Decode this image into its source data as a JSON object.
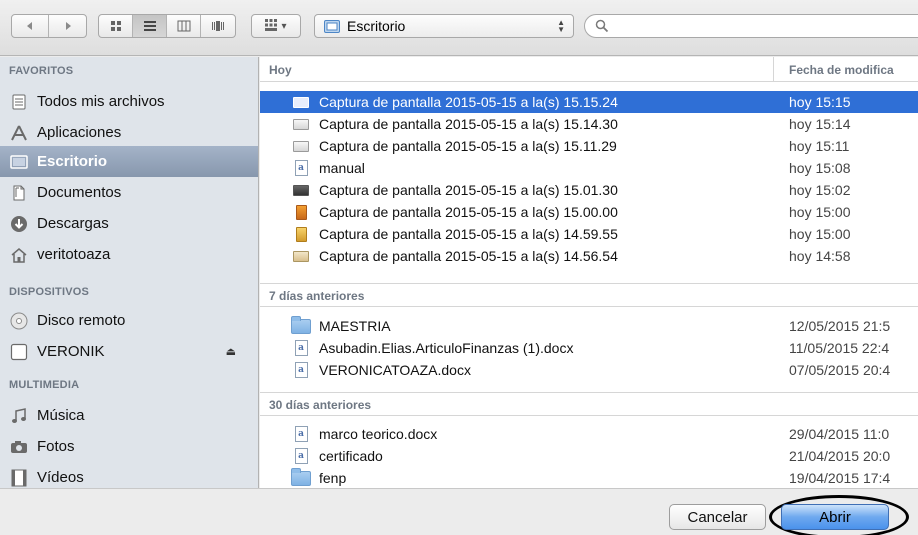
{
  "toolbar": {
    "nav": [
      {
        "icon": "back-arrow-icon",
        "glyph": "◀"
      },
      {
        "icon": "forward-arrow-icon",
        "glyph": "▶"
      }
    ],
    "views": [
      {
        "icon": "icon-view-icon"
      },
      {
        "icon": "list-view-icon",
        "active": true
      },
      {
        "icon": "column-view-icon"
      },
      {
        "icon": "coverflow-view-icon"
      }
    ],
    "arrange": {
      "icon": "arrange-grid-icon",
      "chevron": "▾"
    },
    "location": {
      "label": "Escritorio",
      "icon": "desktop-folder-icon"
    },
    "search": {
      "placeholder": "",
      "icon": "magnifier-icon"
    }
  },
  "sidebar": {
    "sections": [
      {
        "title": "FAVORITOS",
        "items": [
          {
            "label": "Todos mis archivos",
            "icon": "all-files-icon"
          },
          {
            "label": "Aplicaciones",
            "icon": "applications-icon"
          },
          {
            "label": "Escritorio",
            "icon": "desktop-icon",
            "selected": true
          },
          {
            "label": "Documentos",
            "icon": "documents-icon"
          },
          {
            "label": "Descargas",
            "icon": "downloads-icon"
          },
          {
            "label": "veritotoaza",
            "icon": "home-icon"
          }
        ]
      },
      {
        "title": "DISPOSITIVOS",
        "items": [
          {
            "label": "Disco remoto",
            "icon": "remote-disc-icon"
          },
          {
            "label": "VERONIK",
            "icon": "drive-icon",
            "eject": "⏏"
          }
        ]
      },
      {
        "title": "MULTIMEDIA",
        "items": [
          {
            "label": "Música",
            "icon": "music-icon"
          },
          {
            "label": "Fotos",
            "icon": "photos-icon"
          },
          {
            "label": "Vídeos",
            "icon": "videos-icon"
          }
        ]
      }
    ]
  },
  "list": {
    "columns": {
      "name": "Hoy",
      "date": "Fecha de modifica"
    },
    "groups": [
      {
        "title": "",
        "rows": [
          {
            "name": "Captura de pantalla 2015-05-15 a la(s) 15.15.24",
            "date": "hoy 15:15",
            "kind": "image",
            "selected": true
          },
          {
            "name": "Captura de pantalla 2015-05-15 a la(s) 15.14.30",
            "date": "hoy 15:14",
            "kind": "image"
          },
          {
            "name": "Captura de pantalla 2015-05-15 a la(s) 15.11.29",
            "date": "hoy 15:11",
            "kind": "image"
          },
          {
            "name": "manual",
            "date": "hoy 15:08",
            "kind": "doc"
          },
          {
            "name": "Captura de pantalla 2015-05-15 a la(s) 15.01.30",
            "date": "hoy 15:02",
            "kind": "image-dark"
          },
          {
            "name": "Captura de pantalla 2015-05-15 a la(s) 15.00.00",
            "date": "hoy 15:00",
            "kind": "image-orange"
          },
          {
            "name": "Captura de pantalla 2015-05-15 a la(s) 14.59.55",
            "date": "hoy 15:00",
            "kind": "image-gold"
          },
          {
            "name": "Captura de pantalla 2015-05-15 a la(s) 14.56.54",
            "date": "hoy 14:58",
            "kind": "image-tan"
          }
        ]
      },
      {
        "title": "7 días anteriores",
        "rows": [
          {
            "name": "MAESTRIA",
            "date": "12/05/2015 21:5",
            "kind": "folder"
          },
          {
            "name": "Asubadin.Elias.ArticuloFinanzas (1).docx",
            "date": "11/05/2015 22:4",
            "kind": "doc"
          },
          {
            "name": "VERONICATOAZA.docx",
            "date": "07/05/2015 20:4",
            "kind": "doc"
          }
        ]
      },
      {
        "title": "30 días anteriores",
        "rows": [
          {
            "name": "marco teorico.docx",
            "date": "29/04/2015 11:0",
            "kind": "doc"
          },
          {
            "name": "certificado",
            "date": "21/04/2015 20:0",
            "kind": "doc"
          },
          {
            "name": "fenp",
            "date": "19/04/2015 17:4",
            "kind": "folder"
          }
        ]
      }
    ]
  },
  "footer": {
    "cancel_label": "Cancelar",
    "open_label": "Abrir"
  }
}
